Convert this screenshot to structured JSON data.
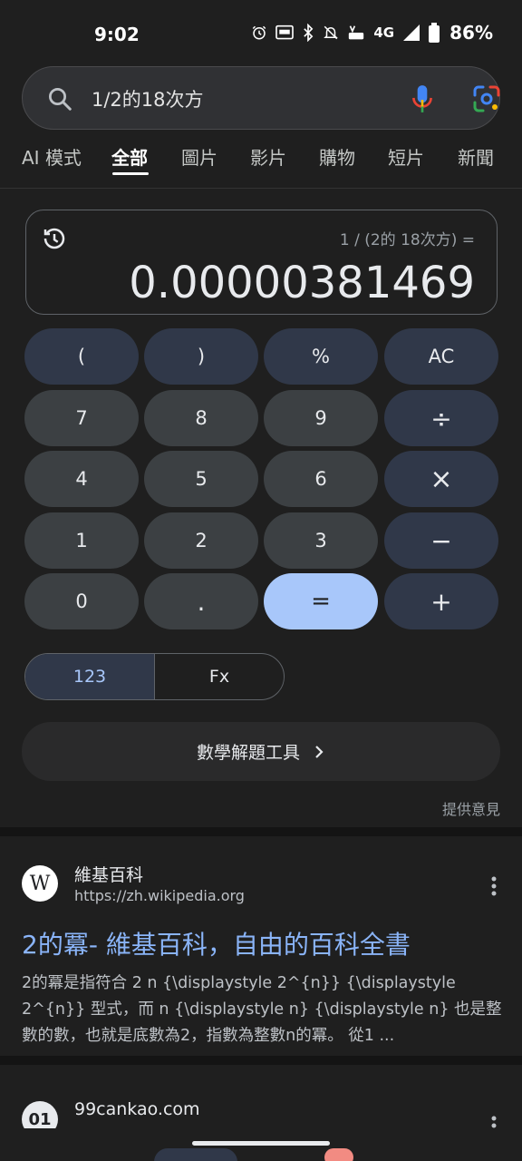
{
  "status": {
    "time": "9:02",
    "network": "4G",
    "battery": "86%"
  },
  "search": {
    "query": "1/2的18次方"
  },
  "tabs": [
    {
      "label": "AI 模式"
    },
    {
      "label": "全部"
    },
    {
      "label": "圖片"
    },
    {
      "label": "影片"
    },
    {
      "label": "購物"
    },
    {
      "label": "短片"
    },
    {
      "label": "新聞"
    }
  ],
  "calculator": {
    "expression": "1 / (2的 18次方) =",
    "result": "0.00000381469",
    "keys": {
      "lparen": "(",
      "rparen": ")",
      "percent": "%",
      "ac": "AC",
      "seven": "7",
      "eight": "8",
      "nine": "9",
      "divide": "÷",
      "four": "4",
      "five": "5",
      "six": "6",
      "multiply": "×",
      "one": "1",
      "two": "2",
      "three": "3",
      "minus": "−",
      "zero": "0",
      "dot": ".",
      "equals": "=",
      "plus": "+"
    },
    "mode_numeric": "123",
    "mode_functions": "Fx",
    "math_tools_label": "數學解題工具",
    "feedback_label": "提供意見"
  },
  "results": [
    {
      "favicon": "W",
      "site": "維基百科",
      "url": "https://zh.wikipedia.org",
      "title": "2的冪- 維基百科，自由的百科全書",
      "snippet": "2的冪是指符合 2 n {\\displaystyle 2^{n}} {\\displaystyle 2^{n}} 型式，而 n {\\displaystyle n} {\\displaystyle n} 也是整數的數，也就是底數為2，指數為整數n的冪。 從1 ..."
    },
    {
      "favicon": "01",
      "site": "99cankao.com"
    }
  ],
  "colors": {
    "background": "#1f1f1f",
    "link": "#8ab4f8",
    "equals_key": "#a8c7fa",
    "operator_key": "#303849"
  }
}
